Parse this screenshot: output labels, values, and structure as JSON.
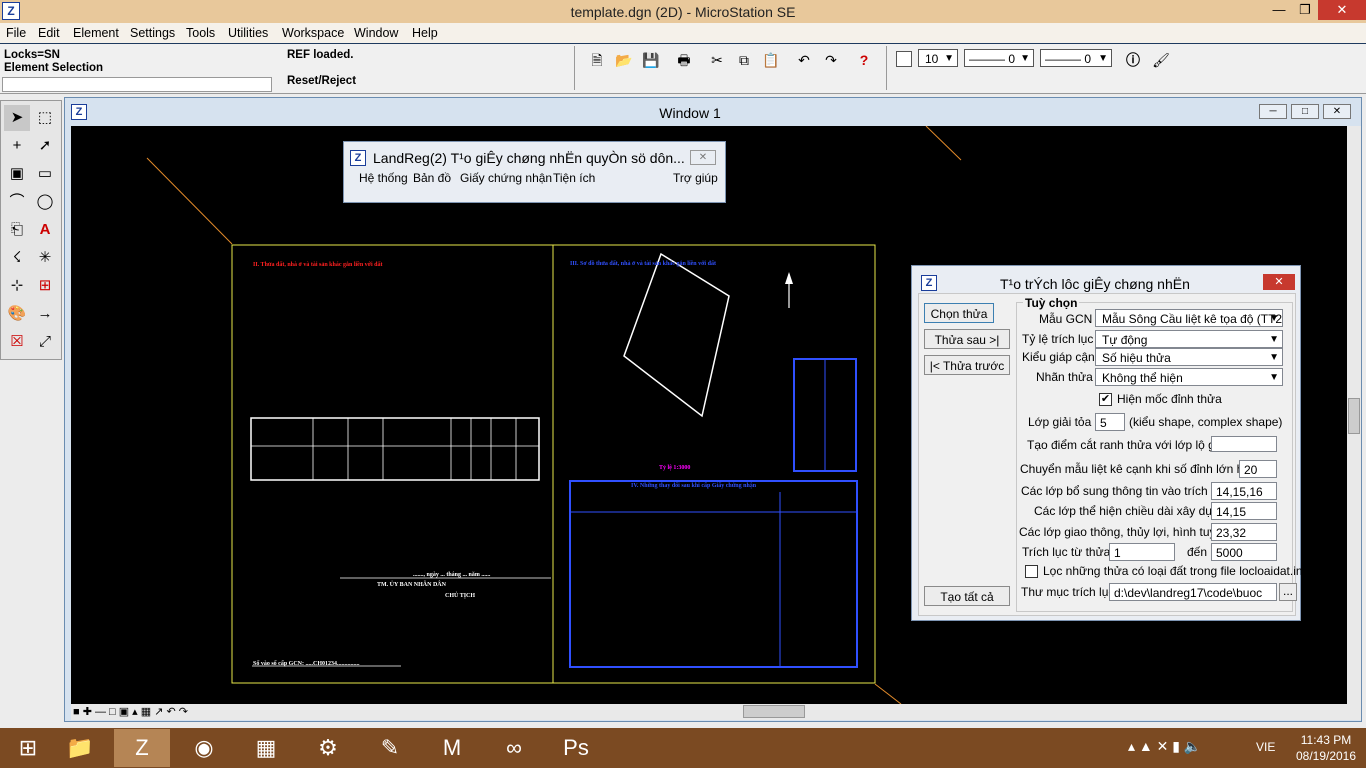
{
  "app": {
    "title": "template.dgn (2D) - MicroStation SE",
    "accent": "#e8c89b"
  },
  "menu": [
    "File",
    "Edit",
    "Element",
    "Settings",
    "Tools",
    "Utilities",
    "Workspace",
    "Window",
    "Help"
  ],
  "status": {
    "locks": "Locks=SN",
    "mode": "Element Selection",
    "msg1": "REF loaded.",
    "msg2": "Reset/Reject"
  },
  "toolbar": {
    "weight": "10",
    "style": "0",
    "lineweight": "0"
  },
  "window1": {
    "title": "Window 1"
  },
  "landreg": {
    "title": "LandReg(2) T¹o giÊy chøng nhËn quyÒn sö dôn...",
    "menu": [
      "Hệ thống",
      "Bản đồ",
      "Giấy chứng nhận",
      "Tiện ích",
      "Trợ giúp"
    ]
  },
  "extract": {
    "title": "T¹o trÝch lôc giÊy chøng nhËn",
    "group": "Tuỳ chọn",
    "buttons": {
      "select": "Chọn thửa",
      "next": "Thửa sau >|",
      "prev": "|< Thửa trước",
      "all": "Tạo tất cả",
      "browse": "..."
    },
    "labels": {
      "template": "Mẫu GCN",
      "scale": "Tỷ lệ trích lục",
      "adjacent": "Kiểu giáp cận",
      "label": "Nhãn thửa",
      "showcorner": "Hiện mốc đỉnh thửa",
      "solvelevel": "Lớp giải tỏa",
      "solvenote": "(kiểu shape, complex shape)",
      "cutpoint": "Tạo điểm cắt ranh thửa với lớp lộ giới",
      "switch": "Chuyển mẫu liệt kê cạnh khi số đỉnh lớn hơn",
      "extra": "Các lớp bổ sung thông tin vào trích lục",
      "building": "Các lớp thể hiện chiều dài xây dựng",
      "traffic": "Các lớp giao thông, thủy lợi, hình tuyến",
      "from": "Trích lục từ thửa",
      "to": "đến",
      "filter": "Lọc những thửa có loại đất trong file locloaidat.ini",
      "folder": "Thư mục trích lục"
    },
    "values": {
      "template": "Mẫu Sông Cầu liệt kê tọa độ (TT2",
      "scale": "Tự động",
      "adjacent": "Số hiệu thửa",
      "label": "Không thể hiện",
      "solvelevel": "5",
      "cutpoint": "",
      "switch": "20",
      "extra": "14,15,16",
      "building": "14,15",
      "traffic": "23,32",
      "from": "1",
      "to": "5000",
      "folder": "d:\\dev\\landreg17\\code\\buoc"
    },
    "checks": {
      "showcorner": true,
      "filter": false
    }
  },
  "sheet": {
    "left_heading": "II. Thửa đất, nhà ở và tài sản khác gắn liền với đất",
    "right_heading": "III. Sơ đồ thửa đất, nhà ở và tài sản khác gắn liền với đất",
    "scale_label": "Tỷ lệ 1:3000",
    "changes_heading": "IV. Những thay đổi sau khi cấp Giấy chứng nhận",
    "signature": "TM. ỦY BAN NHÂN DÂN",
    "chair": "CHỦ TỊCH",
    "date_line": "......., ngày ... tháng ... năm ......",
    "cert": "Số vào sổ cấp GCN: .....CH01234..............."
  },
  "tray": {
    "lang": "VIE",
    "time": "11:43 PM",
    "date": "08/19/2016"
  }
}
